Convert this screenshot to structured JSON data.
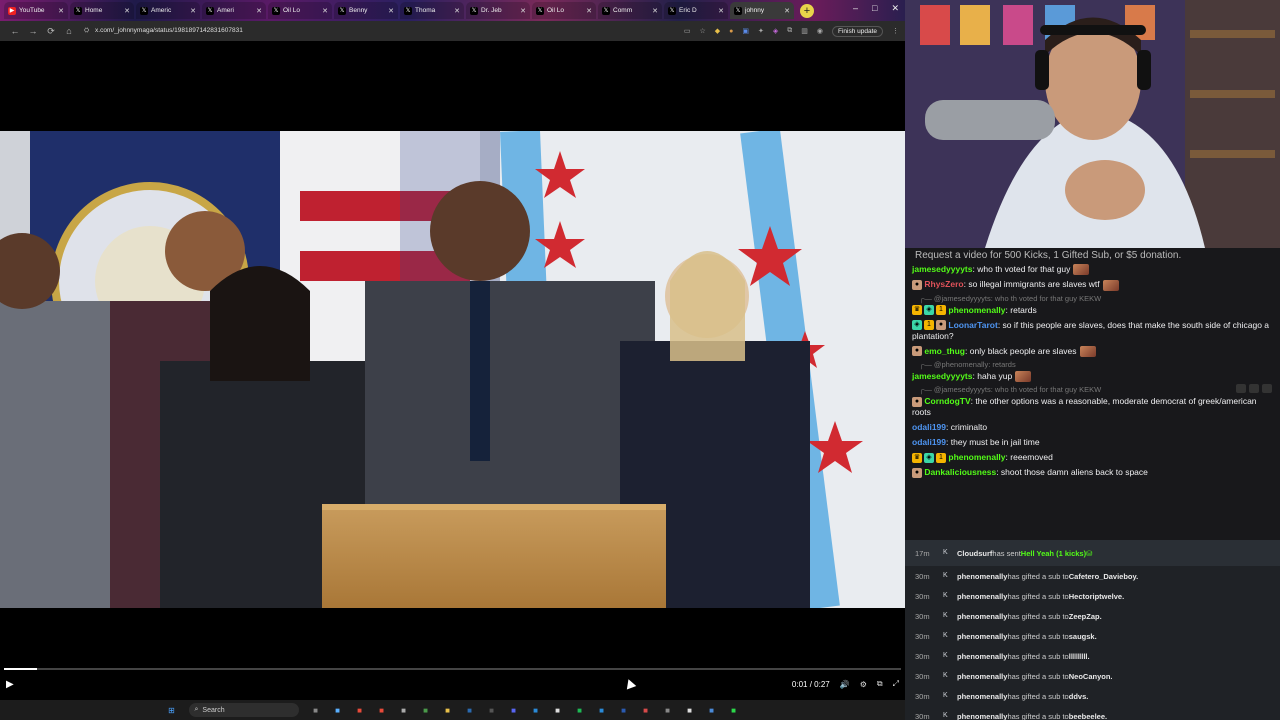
{
  "browser": {
    "tabs": [
      {
        "label": "YouTube",
        "icon": "youtube-icon",
        "color": "#e22"
      },
      {
        "label": "Home",
        "icon": "x-icon",
        "color": "#000"
      },
      {
        "label": "Americ",
        "icon": "x-icon",
        "color": "#000"
      },
      {
        "label": "Ameri",
        "icon": "x-icon",
        "color": "#000"
      },
      {
        "label": "Oil Lo",
        "icon": "x-icon",
        "color": "#000"
      },
      {
        "label": "Benny",
        "icon": "x-icon",
        "color": "#000"
      },
      {
        "label": "Thoma",
        "icon": "x-icon",
        "color": "#000"
      },
      {
        "label": "Dr. Jeb",
        "icon": "x-icon",
        "color": "#000"
      },
      {
        "label": "Oil Lo",
        "icon": "x-icon",
        "color": "#000"
      },
      {
        "label": "Comm",
        "icon": "x-icon",
        "color": "#000"
      },
      {
        "label": "Eric D",
        "icon": "x-icon",
        "color": "#000"
      },
      {
        "label": "johnny",
        "icon": "x-icon",
        "color": "#000",
        "active": true
      }
    ],
    "new_tab": "+",
    "window_controls": [
      "–",
      "□",
      "✕"
    ],
    "nav": {
      "back": "←",
      "forward": "→",
      "reload": "⟳",
      "home": "⌂"
    },
    "url": "x.com/_johnnymaga/status/1981897142831607831",
    "finish_update": "Finish update"
  },
  "video": {
    "time": "0:01 / 0:27",
    "progress": 0.037,
    "play": "▶",
    "volume": "🔊",
    "settings": "⚙",
    "fullscreen": "⤢"
  },
  "taskbar": {
    "search_label": "Search",
    "icons": [
      "windows-icon",
      "task-view-icon",
      "copilot-icon",
      "chrome-icon",
      "chrome-alt-icon",
      "media-icon",
      "xbox-icon",
      "file-explorer-icon",
      "steam-icon",
      "obs-icon",
      "discord-icon",
      "edge-icon",
      "notion-icon",
      "spotify-icon",
      "vscode-icon",
      "word-icon",
      "maps-icon",
      "snipping-icon",
      "capcut-icon",
      "photos-icon",
      "green-app-icon"
    ]
  },
  "chat": {
    "header": "Request a video for 500 Kicks, 1 Gifted Sub, or $5 donation.",
    "messages": [
      {
        "reply": "",
        "user": "jamesedyyyyts",
        "color": "#53fc18",
        "badges": [],
        "text": "who th voted for that guy",
        "emote": true
      },
      {
        "reply": "",
        "user": "RhysZero",
        "color": "#e0525a",
        "badges": [
          "avatar"
        ],
        "text": "so illegal immigrants are slaves wtf",
        "emote": true
      },
      {
        "reply": "@jamesedyyyyts: who th voted for that guy KEKW",
        "user": "phenomenally",
        "color": "#53fc18",
        "badges": [
          "crown",
          "gift",
          "one"
        ],
        "text": "retards",
        "emote": false
      },
      {
        "reply": "",
        "user": "LoonarTarot",
        "color": "#4e95f2",
        "badges": [
          "gift",
          "one",
          "avatar"
        ],
        "text": "so if this people are slaves, does that make the south side of chicago a plantation?",
        "emote": false
      },
      {
        "reply": "",
        "user": "emo_thug",
        "color": "#53fc18",
        "badges": [
          "avatar"
        ],
        "text": "only black people are slaves",
        "emote": true
      },
      {
        "reply": "@phenomenally: retards",
        "user": "jamesedyyyyts",
        "color": "#53fc18",
        "badges": [],
        "text": "haha yup",
        "emote": true
      },
      {
        "reply": "@jamesedyyyyts: who th voted for that guy KEKW",
        "user": "CorndogTV",
        "color": "#53fc18",
        "badges": [
          "avatar"
        ],
        "text": "the other options was a reasonable, moderate democrat of greek/american roots",
        "emote": false
      },
      {
        "reply": "",
        "user": "odali199",
        "color": "#4e95f2",
        "badges": [],
        "text": "criminalto",
        "emote": false
      },
      {
        "reply": "",
        "user": "odali199",
        "color": "#4e95f2",
        "badges": [],
        "text": "they must be in jail time",
        "emote": false
      },
      {
        "reply": "",
        "user": "phenomenally",
        "color": "#53fc18",
        "badges": [
          "crown",
          "gift",
          "one"
        ],
        "text": "reeemoved",
        "emote": false
      },
      {
        "reply": "",
        "user": "Dankaliciousness",
        "color": "#53fc18",
        "badges": [
          "avatar"
        ],
        "text": "shoot those damn aliens back to space",
        "emote": false
      }
    ]
  },
  "events": [
    {
      "ago": "17m",
      "who": "Cloudsurf",
      "action": "has sent",
      "target": "Hell Yeah (1 kicks)",
      "green": true
    },
    {
      "ago": "30m",
      "who": "phenomenally",
      "action": "has gifted a sub to",
      "target": "Cafetero_Davieboy."
    },
    {
      "ago": "30m",
      "who": "phenomenally",
      "action": "has gifted a sub to",
      "target": "Hectoriptwelve."
    },
    {
      "ago": "30m",
      "who": "phenomenally",
      "action": "has gifted a sub to",
      "target": "ZeepZap."
    },
    {
      "ago": "30m",
      "who": "phenomenally",
      "action": "has gifted a sub to",
      "target": "saugsk."
    },
    {
      "ago": "30m",
      "who": "phenomenally",
      "action": "has gifted a sub to",
      "target": "lllllllll."
    },
    {
      "ago": "30m",
      "who": "phenomenally",
      "action": "has gifted a sub to",
      "target": "NeoCanyon."
    },
    {
      "ago": "30m",
      "who": "phenomenally",
      "action": "has gifted a sub to",
      "target": "ddvs."
    },
    {
      "ago": "30m",
      "who": "phenomenally",
      "action": "has gifted a sub to",
      "target": "beebeelee."
    }
  ],
  "colors": {
    "kick_green": "#53fc18",
    "chat_bg": "#18181b",
    "events_bg": "#1f2226"
  }
}
